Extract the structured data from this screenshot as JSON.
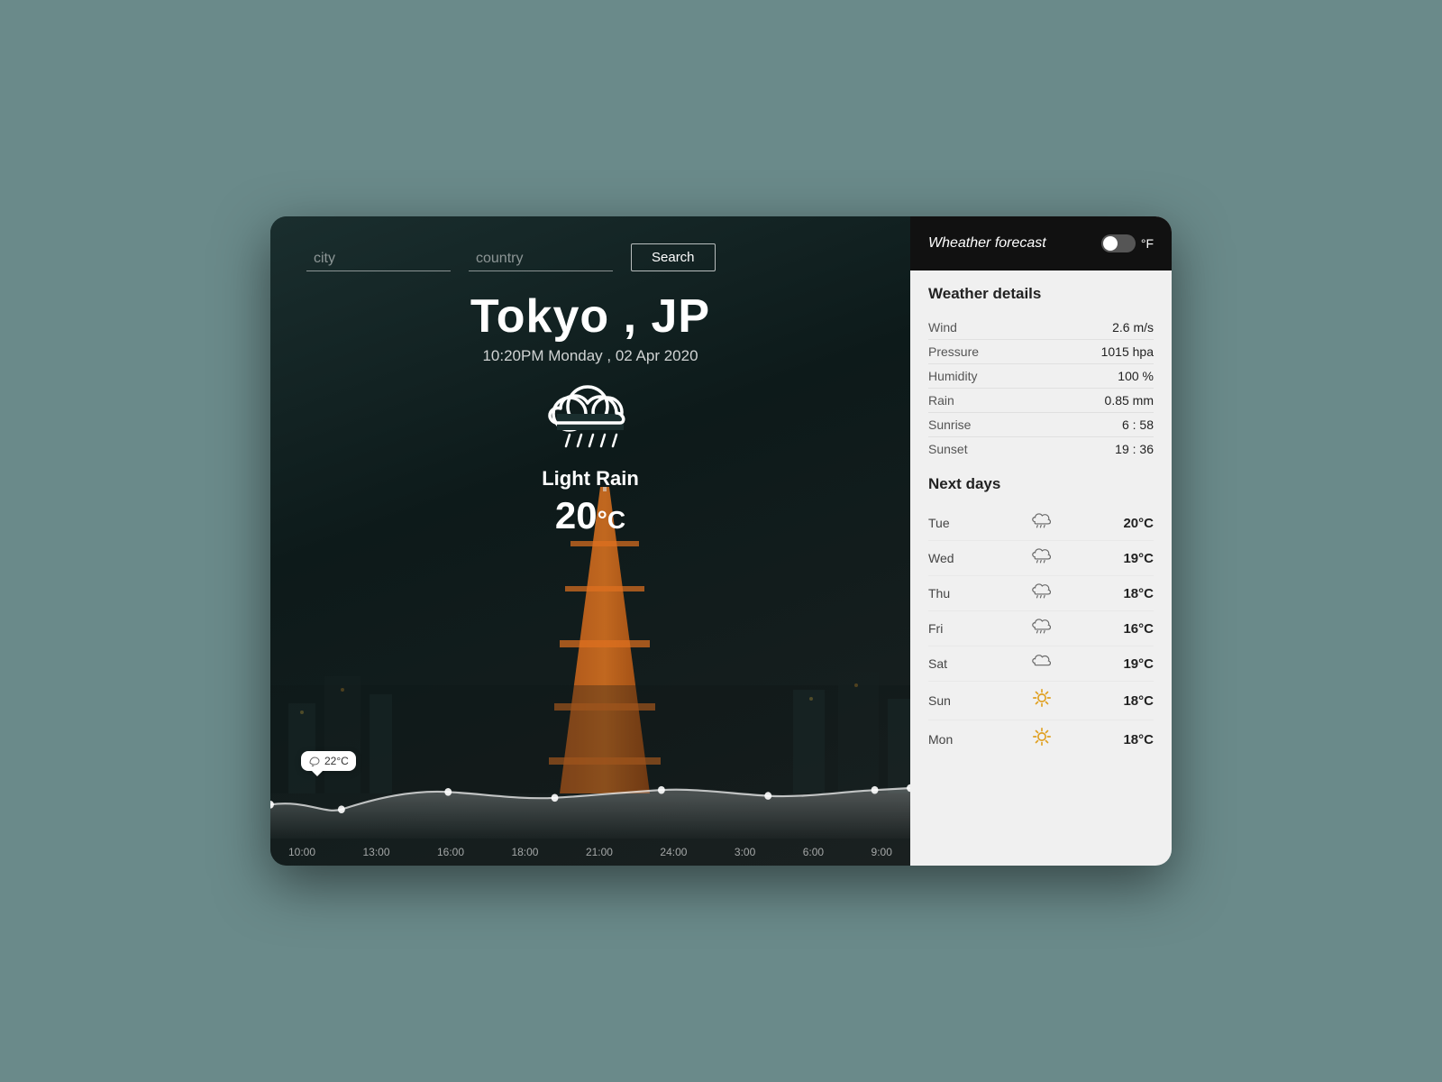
{
  "header": {
    "title": "Wheather forecast",
    "unit": "°F"
  },
  "search": {
    "city_placeholder": "city",
    "country_placeholder": "country",
    "button_label": "Search"
  },
  "current": {
    "city": "Tokyo",
    "country": "JP",
    "datetime": "10:20PM  Monday , 02 Apr 2020",
    "condition": "Light Rain",
    "temperature": "20",
    "degree_symbol": "°C"
  },
  "details": {
    "section_title": "Weather details",
    "rows": [
      {
        "label": "Wind",
        "value": "2.6 m/s"
      },
      {
        "label": "Pressure",
        "value": "1015 hpa"
      },
      {
        "label": "Humidity",
        "value": "100 %"
      },
      {
        "label": "Rain",
        "value": "0.85 mm"
      },
      {
        "label": "Sunrise",
        "value": "6 : 58"
      },
      {
        "label": "Sunset",
        "value": "19 : 36"
      }
    ]
  },
  "nextdays": {
    "section_title": "Next days",
    "rows": [
      {
        "day": "Tue",
        "icon": "rain",
        "temp": "20°C"
      },
      {
        "day": "Wed",
        "icon": "rain",
        "temp": "19°C"
      },
      {
        "day": "Thu",
        "icon": "rain",
        "temp": "18°C"
      },
      {
        "day": "Fri",
        "icon": "rain",
        "temp": "16°C"
      },
      {
        "day": "Sat",
        "icon": "cloud",
        "temp": "19°C"
      },
      {
        "day": "Sun",
        "icon": "sun",
        "temp": "18°C"
      },
      {
        "day": "Mon",
        "icon": "sun",
        "temp": "18°C"
      }
    ]
  },
  "chart": {
    "tooltip_temp": "22°C",
    "labels": [
      "10:00",
      "13:00",
      "16:00",
      "18:00",
      "21:00",
      "24:00",
      "3:00",
      "6:00",
      "9:00"
    ]
  }
}
